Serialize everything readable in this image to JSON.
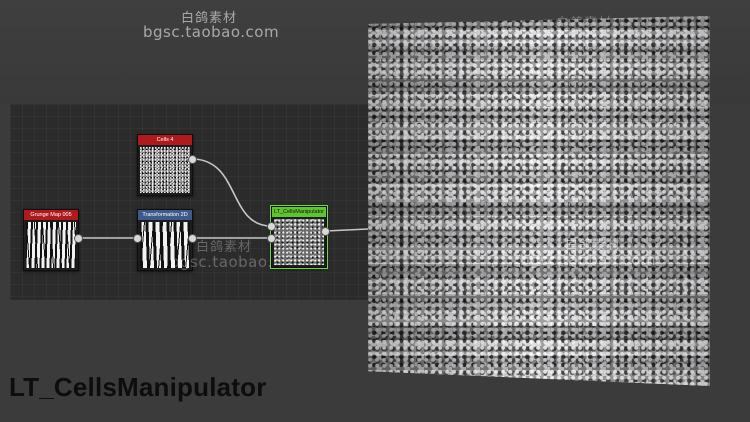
{
  "title": "LT_CellsManipulator",
  "watermarks": {
    "top_cn": "白鸽素材",
    "top_url": "bgsc.taobao.com",
    "right_cn": "白鸽素材",
    "mid_cn": "白鸽素材",
    "mid_url": "bgsc.taobao.com",
    "panel_cn": "白鸽素材",
    "panel_url": "bgsc.taobao.com"
  },
  "nodes": [
    {
      "label": "Cells 4",
      "color": "#b0191e"
    },
    {
      "label": "Grunge Map 005",
      "color": "#b0191e"
    },
    {
      "label": "Transformation 2D",
      "color": "#3e5a8c"
    },
    {
      "label": "LT_CellsManipulator",
      "color": "#5ec52e"
    }
  ],
  "colors": {
    "background": "#3b3b3b",
    "graph_background": "#2b2b2b",
    "wire": "#c8c8c8"
  }
}
